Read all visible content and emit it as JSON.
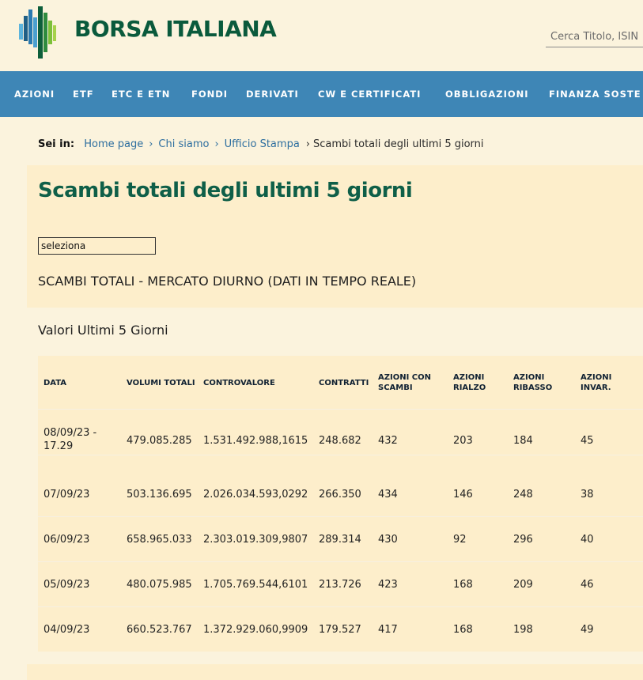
{
  "header": {
    "logo_text": "BORSA ITALIANA",
    "search_placeholder": "Cerca Titolo, ISIN"
  },
  "nav": {
    "items": [
      "AZIONI",
      "ETF",
      "ETC E ETN",
      "FONDI",
      "DERIVATI",
      "CW E CERTIFICATI",
      "OBBLIGAZIONI",
      "FINANZA SOSTE"
    ]
  },
  "breadcrumb": {
    "label": "Sei in:",
    "items": [
      "Home page",
      "Chi siamo",
      "Ufficio Stampa"
    ],
    "current": "Scambi totali degli ultimi 5 giorni"
  },
  "page": {
    "title": "Scambi totali degli ultimi 5 giorni",
    "select_value": "seleziona",
    "subtitle": "SCAMBI TOTALI - MERCATO DIURNO (DATI IN TEMPO REALE)",
    "section_title": "Valori Ultimi 5 Giorni"
  },
  "table": {
    "headers": [
      "DATA",
      "VOLUMI TOTALI",
      "CONTROVALORE",
      "CONTRATTI",
      "AZIONI CON SCAMBI",
      "AZIONI RIALZO",
      "AZIONI RIBASSO",
      "AZIONI INVAR."
    ],
    "rows": [
      [
        "08/09/23 - 17.29",
        "479.085.285",
        "1.531.492.988,1615",
        "248.682",
        "432",
        "203",
        "184",
        "45"
      ],
      [
        "07/09/23",
        "503.136.695",
        "2.026.034.593,0292",
        "266.350",
        "434",
        "146",
        "248",
        "38"
      ],
      [
        "06/09/23",
        "658.965.033",
        "2.303.019.309,9807",
        "289.314",
        "430",
        "92",
        "296",
        "40"
      ],
      [
        "05/09/23",
        "480.075.985",
        "1.705.769.544,6101",
        "213.726",
        "423",
        "168",
        "209",
        "46"
      ],
      [
        "04/09/23",
        "660.523.767",
        "1.372.929.060,9909",
        "179.527",
        "417",
        "168",
        "198",
        "49"
      ]
    ]
  },
  "colors": {
    "brand_green": "#0a5a3c",
    "nav_blue": "#3e86b6",
    "link_blue": "#2d6e9f",
    "page_bg": "#fbf3dd",
    "panel_bg": "#fdeecb"
  }
}
